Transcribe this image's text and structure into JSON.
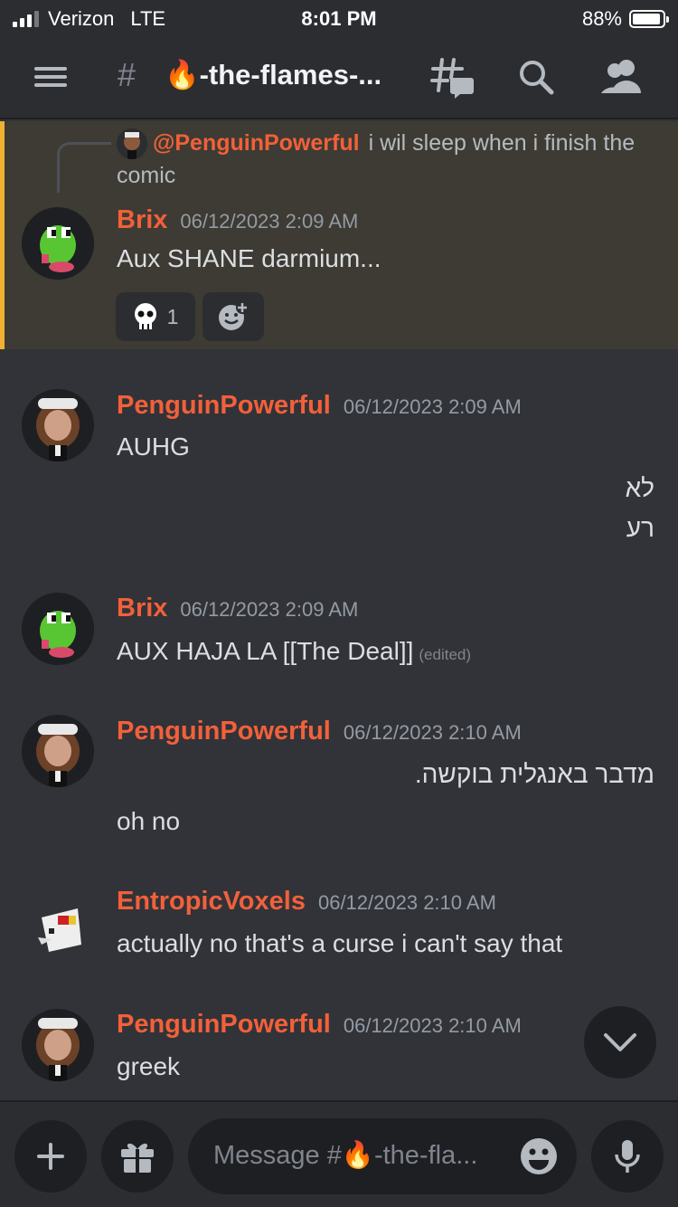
{
  "status_bar": {
    "carrier": "Verizon",
    "network": "LTE",
    "time": "8:01 PM",
    "battery": "88%",
    "battery_level": 0.88
  },
  "header": {
    "hash": "#",
    "channel_name": "🔥-the-flames-..."
  },
  "reply": {
    "mention": "@PenguinPowerful",
    "text": "i wil sleep when i finish the comic"
  },
  "messages": [
    {
      "author": "Brix",
      "timestamp": "06/12/2023 2:09 AM",
      "lines": [
        "Aux SHANE darmium..."
      ]
    },
    {
      "author": "PenguinPowerful",
      "timestamp": "06/12/2023 2:09 AM",
      "lines": [
        "AUHG"
      ],
      "rtl_lines": [
        "לא",
        "רע"
      ]
    },
    {
      "author": "Brix",
      "timestamp": "06/12/2023 2:09 AM",
      "lines": [
        "AUX HAJA LA [[The Deal]]"
      ],
      "edited": "(edited)"
    },
    {
      "author": "PenguinPowerful",
      "timestamp": "06/12/2023 2:10 AM",
      "rtl_lines": [
        "מדבר באנגלית בוקשה."
      ],
      "lines": [
        "oh no"
      ]
    },
    {
      "author": "EntropicVoxels",
      "timestamp": "06/12/2023 2:10 AM",
      "lines": [
        "actually no that's a curse i can't say that"
      ]
    },
    {
      "author": "PenguinPowerful",
      "timestamp": "06/12/2023 2:10 AM",
      "lines": [
        "greek"
      ]
    }
  ],
  "reactions": [
    {
      "emoji": "skull-icon",
      "count": "1"
    }
  ],
  "composer": {
    "placeholder": "Message #🔥-the-fla..."
  },
  "colors": {
    "author": "#f2603a",
    "highlight_border": "#f0b232",
    "background": "#313338"
  }
}
